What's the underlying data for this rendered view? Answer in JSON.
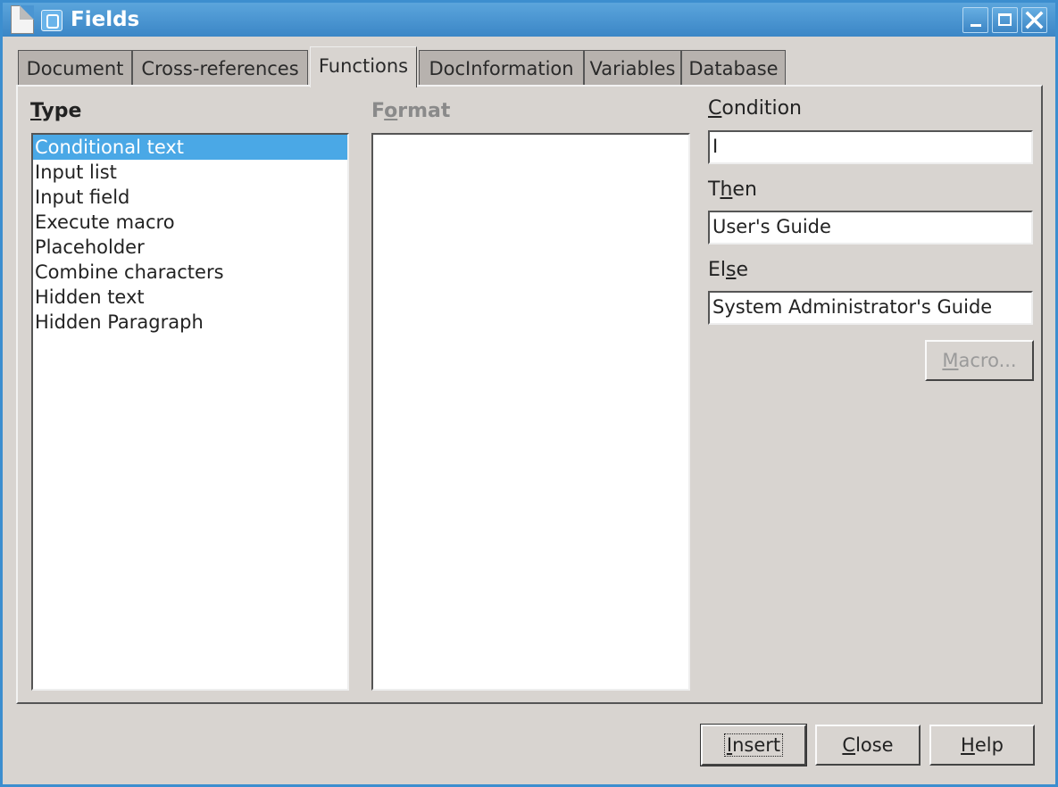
{
  "window": {
    "title": "Fields",
    "colors": {
      "titlebar": "#3b86c6",
      "selection": "#4aa8e6",
      "dialog_bg": "#d8d4d0"
    },
    "controls": {
      "minimize_icon": "minimize-icon",
      "maximize_icon": "maximize-icon",
      "close_icon": "close-icon"
    }
  },
  "tabs": [
    {
      "label": "Document"
    },
    {
      "label": "Cross-references"
    },
    {
      "label": "Functions",
      "active": true
    },
    {
      "label": "DocInformation"
    },
    {
      "label": "Variables"
    },
    {
      "label": "Database"
    }
  ],
  "type_section": {
    "label_mnemonic": "T",
    "label_rest": "ype",
    "items": [
      "Conditional text",
      "Input list",
      "Input field",
      "Execute macro",
      "Placeholder",
      "Combine characters",
      "Hidden text",
      "Hidden Paragraph"
    ],
    "selected": "Conditional text"
  },
  "format_section": {
    "label_pre": "F",
    "label_mnemonic": "o",
    "label_rest": "rmat",
    "items": []
  },
  "condition": {
    "label_mnemonic": "C",
    "label_rest": "ondition",
    "value": "I"
  },
  "then": {
    "label_pre": "T",
    "label_mnemonic": "h",
    "label_rest": "en",
    "value": "User's Guide"
  },
  "else": {
    "label_pre": "El",
    "label_mnemonic": "s",
    "label_rest": "e",
    "value": "System Administrator's Guide"
  },
  "buttons": {
    "macro": {
      "mnemonic": "M",
      "rest": "acro..."
    },
    "insert": {
      "mnemonic": "I",
      "rest": "nsert"
    },
    "close": {
      "mnemonic": "C",
      "rest": "lose"
    },
    "help": {
      "mnemonic": "H",
      "rest": "elp"
    }
  }
}
